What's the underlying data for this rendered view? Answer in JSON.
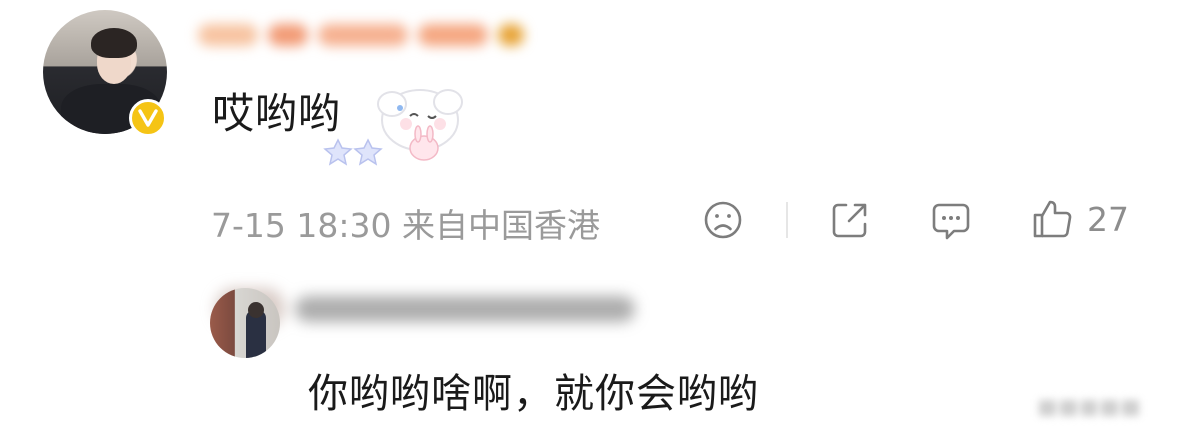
{
  "comment": {
    "text": "哎哟哟",
    "meta": "7-15 18:30 来自中国香港",
    "like_count": "27",
    "icons": {
      "dislike": "sad-face-icon",
      "share": "share-icon",
      "reply": "comment-bubble-icon",
      "like": "thumbs-up-icon",
      "badge": "verified-v-icon"
    },
    "colors": {
      "badge": "#f5c415",
      "text": "#1a1a1a",
      "meta": "#9a9a9a"
    }
  },
  "reply": {
    "text": "你哟哟啥啊，就你会哟哟"
  }
}
